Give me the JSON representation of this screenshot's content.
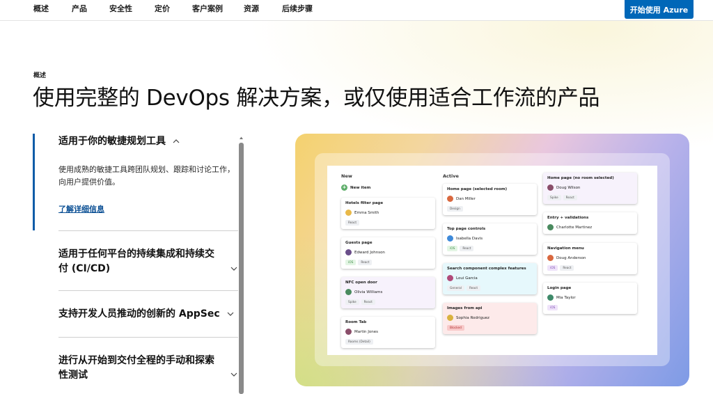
{
  "nav": {
    "items": [
      "概述",
      "产品",
      "安全性",
      "定价",
      "客户案例",
      "资源",
      "后续步骤"
    ],
    "cta": "开始使用 Azure"
  },
  "hero": {
    "eyebrow": "概述",
    "headline": "使用完整的 DevOps 解决方案，或仅使用适合工作流的产品"
  },
  "accordion": {
    "items": [
      {
        "title": "适用于你的敏捷规划工具",
        "expanded": true,
        "description": "使用成熟的敏捷工具跨团队规划、跟踪和讨论工作，向用户提供价值。",
        "link": "了解详细信息"
      },
      {
        "title_line1": "适用于任何平台的持续集成和持续交",
        "title_line2": "付 (CI/CD)",
        "expanded": false
      },
      {
        "title": "支持开发人员推动的创新的 AppSec",
        "expanded": false
      },
      {
        "title_line1": "进行从开始到交付全程的手动和探索",
        "title_line2": "性测试",
        "expanded": false
      }
    ]
  },
  "board": {
    "columns": [
      "New",
      "Active"
    ],
    "new_item": "New item",
    "new_cards": [
      {
        "title": "Hotels filter page",
        "person": "Emma Smith",
        "tags": [
          "React"
        ]
      },
      {
        "title": "Guests page",
        "person": "Edward Johnson",
        "tags": [
          "iOS",
          "React"
        ]
      },
      {
        "title": "NFC open door",
        "person": "Olivia Williams",
        "tags": [
          "Spike",
          "React"
        ]
      },
      {
        "title": "Room Tab",
        "person": "Martin Jones",
        "tags": [
          "Rooms (Detail)"
        ]
      }
    ],
    "active_cards": [
      {
        "title": "Home page (selected room)",
        "person": "Dan Miller",
        "tags": [
          "Design"
        ]
      },
      {
        "title": "Top page controls",
        "person": "Isabella Davis",
        "tags": [
          "iOS",
          "React"
        ]
      },
      {
        "title": "Search component complex features",
        "person": "Loui Garcia",
        "tags": [
          "General",
          "React"
        ]
      },
      {
        "title": "Images from api",
        "person": "Sophia Rodriguez",
        "tags": [
          "Blocked"
        ]
      }
    ],
    "third_cards": [
      {
        "title": "Home page (no room selected)",
        "person": "Doug Wilson",
        "tags": [
          "Spike",
          "React"
        ]
      },
      {
        "title": "Entry + validations",
        "person": "Charlotte Martinez",
        "tags": []
      },
      {
        "title": "Navigation menu",
        "person": "Doug Anderson",
        "tags": [
          "iOS",
          "React"
        ]
      },
      {
        "title": "Login page",
        "person": "Mia Taylor",
        "tags": [
          "iOS"
        ]
      }
    ]
  },
  "colors": {
    "accent": "#0067b8",
    "link": "#0a4f94",
    "active_bar": "#0f5ca8"
  }
}
